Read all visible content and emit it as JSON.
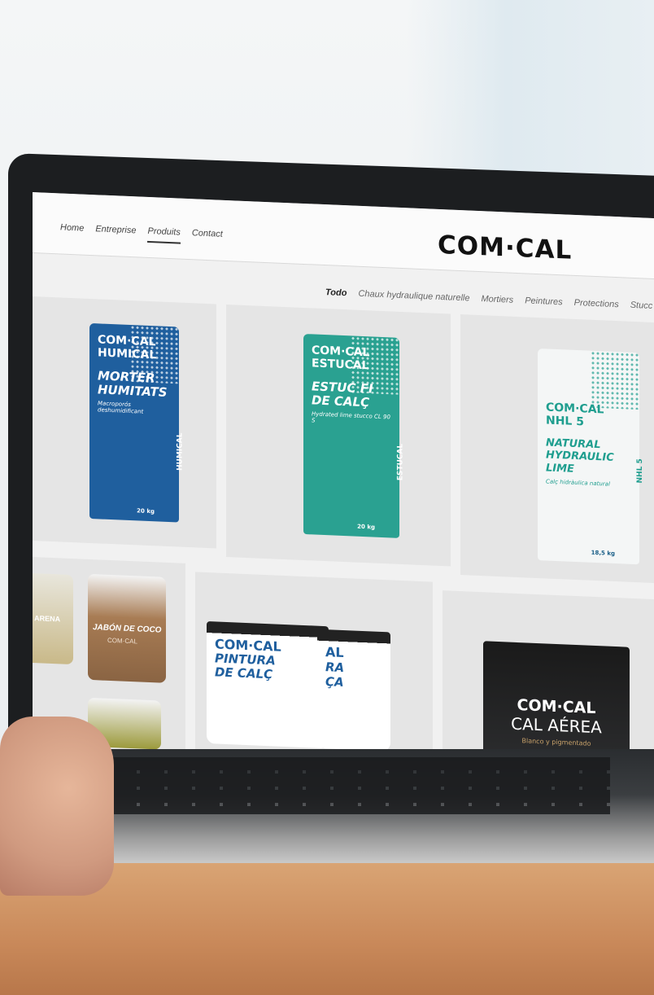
{
  "site": {
    "logo": "COM·CAL",
    "nav": [
      {
        "label": "Home",
        "active": false
      },
      {
        "label": "Entreprise",
        "active": false
      },
      {
        "label": "Produits",
        "active": true
      },
      {
        "label": "Contact",
        "active": false
      }
    ],
    "filters": [
      {
        "label": "Todo",
        "active": true
      },
      {
        "label": "Chaux hydraulique naturelle",
        "active": false
      },
      {
        "label": "Mortiers",
        "active": false
      },
      {
        "label": "Peintures",
        "active": false
      },
      {
        "label": "Protections",
        "active": false
      },
      {
        "label": "Stucc",
        "active": false
      }
    ]
  },
  "products": [
    {
      "brand": "COM·CAL",
      "name": "HUMICAL",
      "sub1": "MORTER",
      "sub2": "HUMITATS",
      "small": "Macroporós deshumidificant",
      "weight": "20 kg",
      "side": "HUMICAL",
      "color": "#1f5f9e"
    },
    {
      "brand": "COM·CAL",
      "name": "ESTUCAL",
      "sub1": "ESTUC FI",
      "sub2": "DE CALÇ",
      "small": "Hydrated lime stucco CL 90 S",
      "weight": "20 kg",
      "side": "ESTUCAL",
      "color": "#2aa191"
    },
    {
      "brand": "COM·CAL",
      "name": "NHL 5",
      "sub1": "NATURAL HYDRAULIC",
      "sub2": "LIME",
      "small": "Calç hidràulica natural",
      "weight": "18,5 kg",
      "side": "NHL 5",
      "color": "#f4f6f6"
    }
  ],
  "bottom_row": {
    "jar_labels": [
      "E ARENA",
      "JABÓN DE COCO"
    ],
    "jar_brand": "COM·CAL",
    "paint_brand": "COM·CAL",
    "paint_name": "PINTURA DE CALÇ",
    "paint_name2": "AL",
    "paint_name3": "RA",
    "paint_name4": "ÇA",
    "bucket_brand": "COM·CAL",
    "bucket_name": "CAL AÉREA",
    "bucket_small": "Blanco y pigmentado"
  },
  "colors": {
    "accent": "#2aa191",
    "blue": "#1f5f9e",
    "bezel": "#1c1e20"
  }
}
